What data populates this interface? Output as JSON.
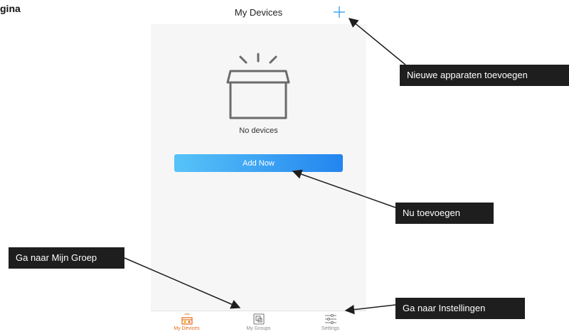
{
  "page": {
    "heading_fragment": "gina"
  },
  "app": {
    "title": "My Devices",
    "add_icon": "plus-icon",
    "empty_state": {
      "icon": "open-box-icon",
      "text": "No devices"
    },
    "add_now_label": "Add Now",
    "tabs": [
      {
        "label": "My Devices",
        "icon": "my-devices-icon",
        "active": true,
        "active_color": "#e46b1f"
      },
      {
        "label": "My Groups",
        "icon": "my-groups-icon",
        "active": false
      },
      {
        "label": "Settings",
        "icon": "settings-sliders-icon",
        "active": false
      }
    ],
    "accent_color": "#2385ef"
  },
  "callouts": {
    "add_devices": "Nieuwe apparaten toevoegen",
    "add_now": "Nu toevoegen",
    "my_group": "Ga naar Mijn Groep",
    "settings": "Ga naar Instellingen"
  }
}
